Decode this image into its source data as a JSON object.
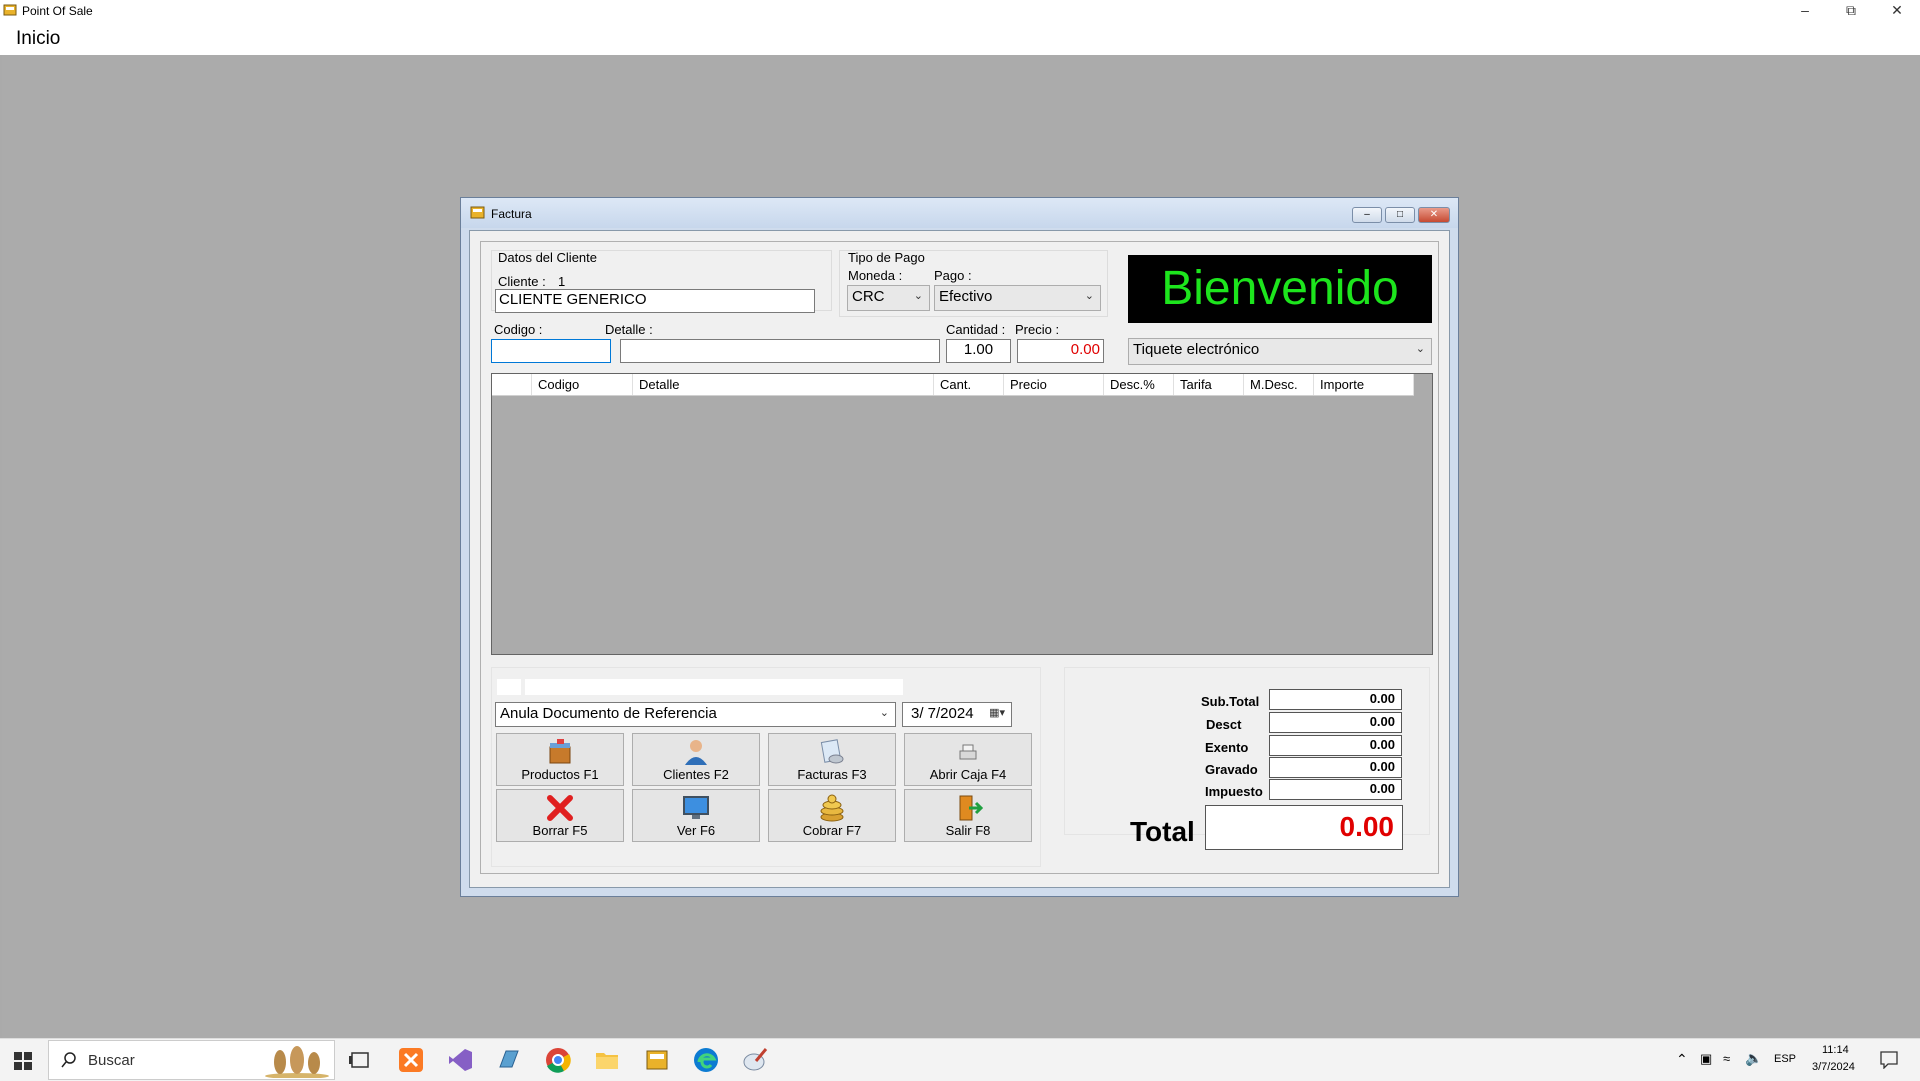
{
  "app": {
    "title": "Point Of Sale",
    "menu": [
      "Inicio"
    ]
  },
  "window": {
    "title": "Factura"
  },
  "cliente": {
    "group_label": "Datos del Cliente",
    "cliente_label": "Cliente :",
    "cliente_id": "1",
    "cliente_nombre": "CLIENTE GENERICO"
  },
  "pago": {
    "group_label": "Tipo de Pago",
    "moneda_label": "Moneda :",
    "moneda_value": "CRC",
    "pago_label": "Pago :",
    "pago_value": "Efectivo"
  },
  "banner": "Bienvenido",
  "doc_type": "Tiquete electrónico",
  "entry": {
    "codigo_label": "Codigo :",
    "codigo_value": "",
    "detalle_label": "Detalle :",
    "detalle_value": "",
    "cantidad_label": "Cantidad :",
    "cantidad_value": "1.00",
    "precio_label": "Precio :",
    "precio_value": "0.00"
  },
  "grid": {
    "columns": [
      "",
      "Codigo",
      "Detalle",
      "Cant.",
      "Precio",
      "Desc.%",
      "Tarifa",
      "M.Desc.",
      "Importe"
    ],
    "rows": []
  },
  "referencia": {
    "value": "Anula Documento de Referencia"
  },
  "fecha": {
    "value": "3/  7/2024"
  },
  "buttons": {
    "productos": "Productos F1",
    "clientes": "Clientes F2",
    "facturas": "Facturas F3",
    "abrir_caja": "Abrir Caja F4",
    "borrar": "Borrar F5",
    "ver": "Ver F6",
    "cobrar": "Cobrar F7",
    "salir": "Salir F8"
  },
  "totales": {
    "subtotal_label": "Sub.Total",
    "subtotal": "0.00",
    "desc_label": "Desct",
    "desc": "0.00",
    "exento_label": "Exento",
    "exento": "0.00",
    "gravado_label": "Gravado",
    "gravado": "0.00",
    "impuesto_label": "Impuesto",
    "impuesto": "0.00",
    "total_label": "Total",
    "total": "0.00"
  },
  "taskbar": {
    "search_placeholder": "Buscar",
    "lang": "ESP",
    "time": "11:14",
    "date": "3/7/2024"
  },
  "colors": {
    "banner_text": "#1de51d",
    "total_value": "#e00000",
    "precio_value": "#e00000"
  }
}
